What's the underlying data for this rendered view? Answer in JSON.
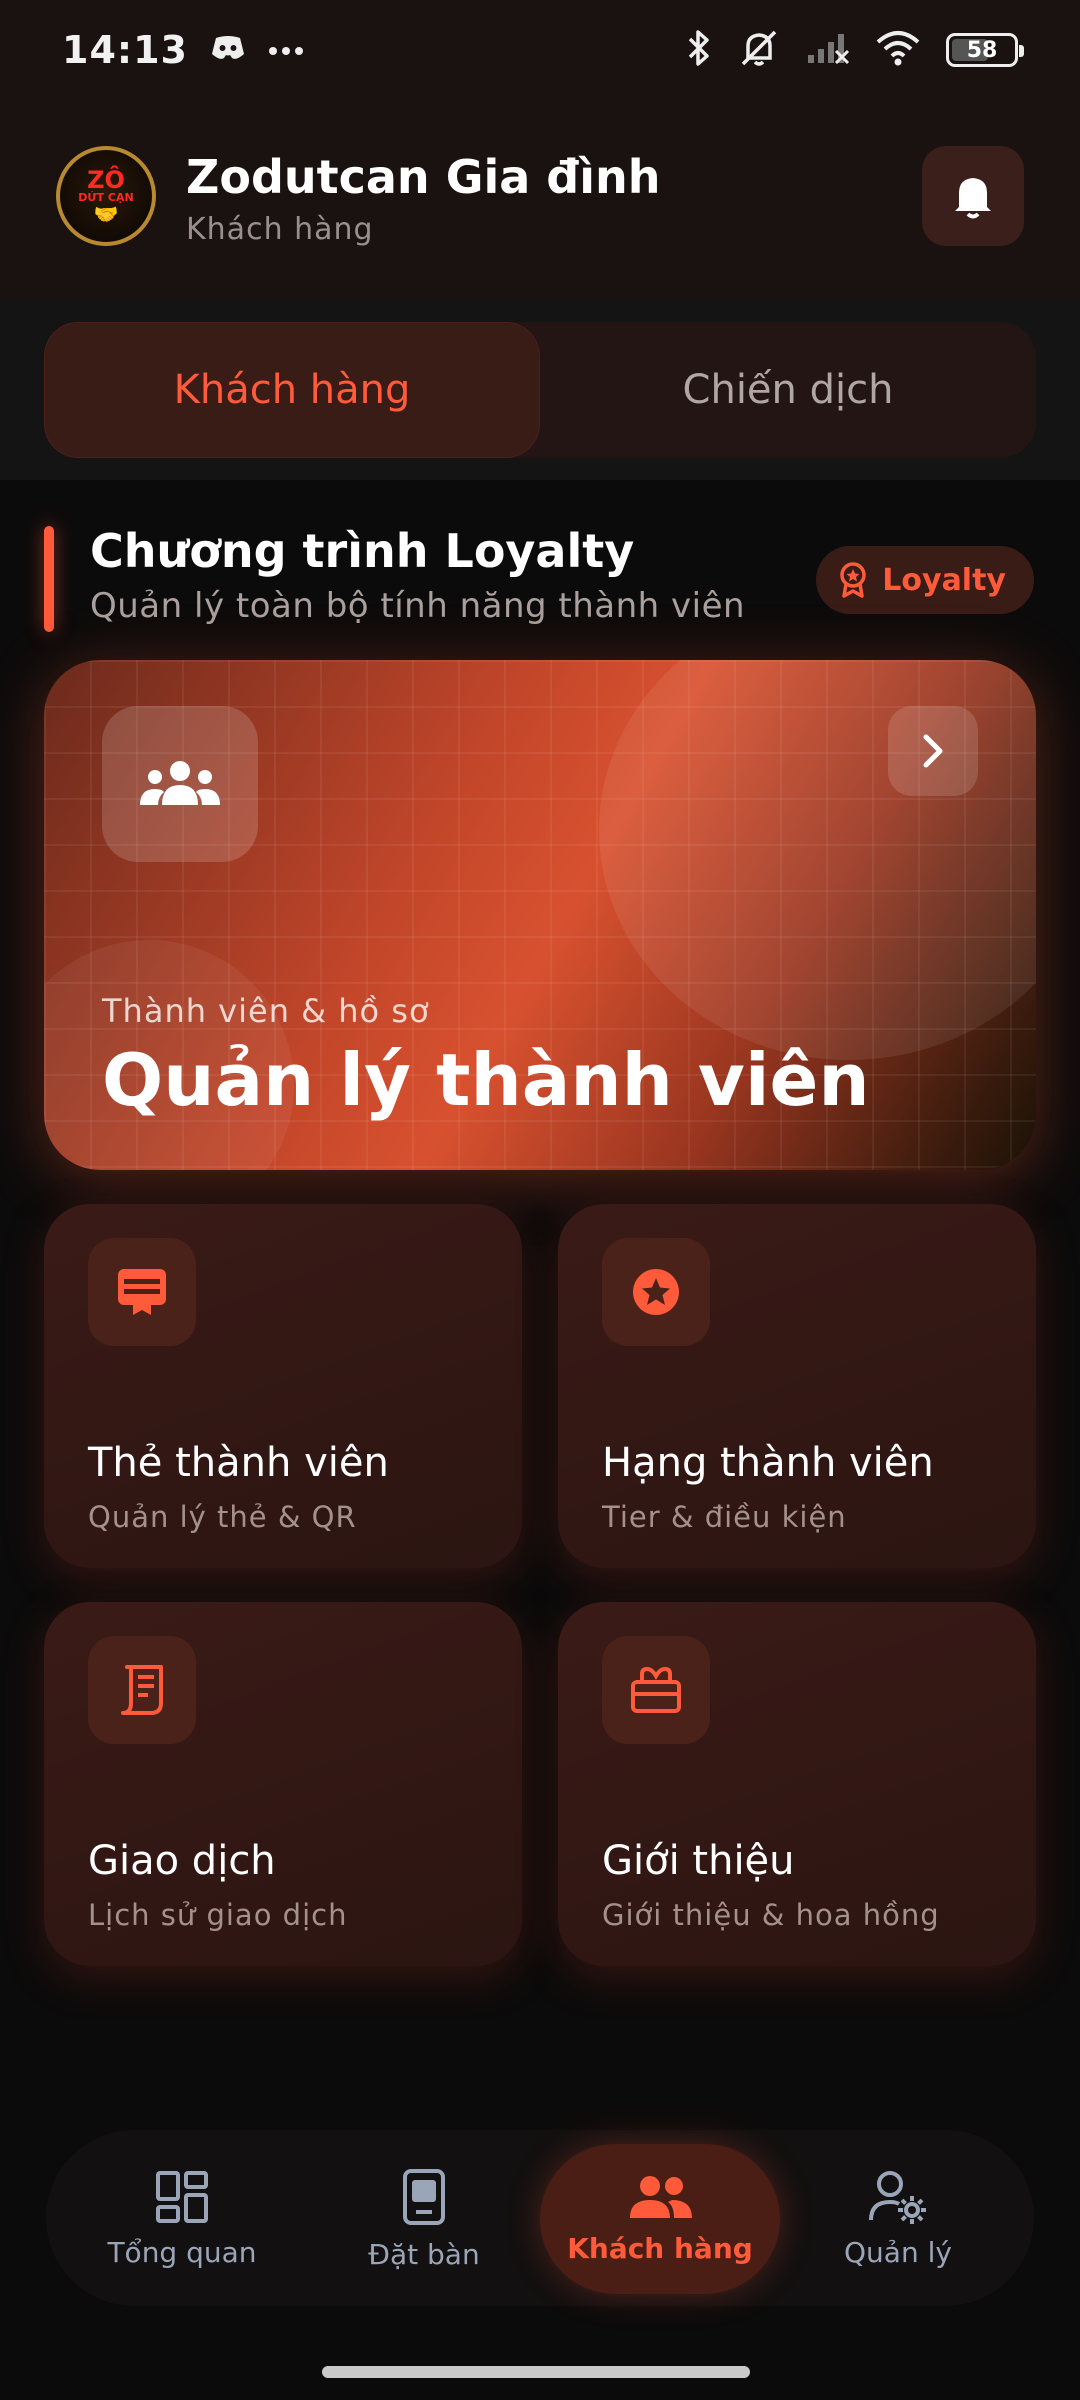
{
  "status_bar": {
    "time": "14:13",
    "battery": "58",
    "icons": [
      "discord-icon",
      "more-dots-icon",
      "bluetooth-icon",
      "mute-icon",
      "signal-icon",
      "wifi-icon",
      "battery-icon"
    ]
  },
  "header": {
    "logo_text_line1": "ZÔ",
    "logo_text_line2": "DỨT CẠN",
    "title": "Zodutcan Gia đình",
    "subtitle": "Khách hàng",
    "notification_icon": "bell-icon"
  },
  "tabs": [
    {
      "label": "Khách hàng",
      "active": true
    },
    {
      "label": "Chiến dịch",
      "active": false
    }
  ],
  "section": {
    "title": "Chương trình Loyalty",
    "subtitle": "Quản lý toàn bộ tính năng thành viên",
    "badge_label": "Loyalty"
  },
  "hero": {
    "kicker": "Thành viên & hồ sơ",
    "title": "Quản lý thành viên",
    "icon": "users-group-icon"
  },
  "cards": [
    {
      "title": "Thẻ thành viên",
      "subtitle": "Quản lý thẻ & QR",
      "icon": "card-icon"
    },
    {
      "title": "Hạng thành viên",
      "subtitle": "Tier & điều kiện",
      "icon": "star-badge-icon"
    },
    {
      "title": "Giao dịch",
      "subtitle": "Lịch sử giao dịch",
      "icon": "receipt-icon"
    },
    {
      "title": "Giới thiệu",
      "subtitle": "Giới thiệu & hoa hồng",
      "icon": "gift-icon"
    }
  ],
  "bottom_nav": [
    {
      "label": "Tổng quan",
      "icon": "dashboard-icon",
      "active": false
    },
    {
      "label": "Đặt bàn",
      "icon": "table-booking-icon",
      "active": false
    },
    {
      "label": "Khách hàng",
      "icon": "customers-icon",
      "active": true
    },
    {
      "label": "Quản lý",
      "icon": "user-gear-icon",
      "active": false
    }
  ],
  "colors": {
    "accent": "#ff5a3a",
    "background": "#0b0b0b",
    "card": "#2b1512"
  }
}
